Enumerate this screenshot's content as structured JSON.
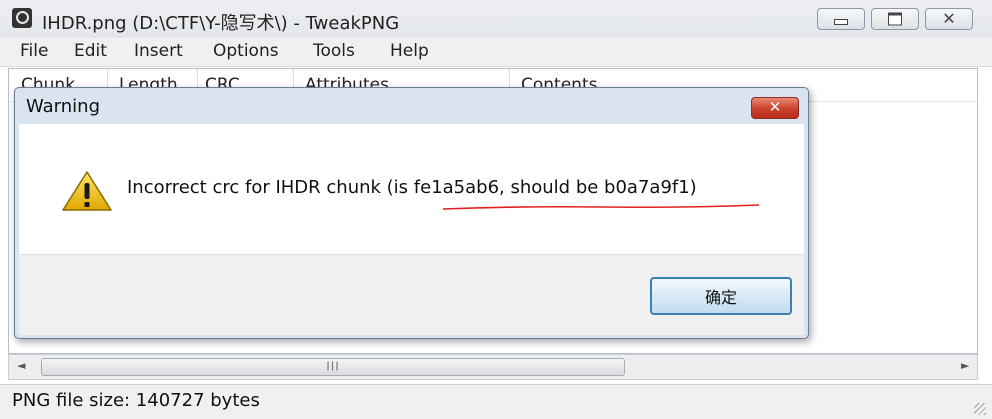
{
  "window": {
    "title": "IHDR.png (D:\\CTF\\Y-隐写术\\) - TweakPNG",
    "icon": "tweakpng-app-icon",
    "controls": {
      "minimize_icon": "minimize-icon",
      "maximize_icon": "maximize-icon",
      "close_glyph": "✕"
    }
  },
  "menu": {
    "items": [
      "File",
      "Edit",
      "Insert",
      "Options",
      "Tools",
      "Help"
    ]
  },
  "list": {
    "columns": [
      "Chunk",
      "Length",
      "CRC",
      "Attributes",
      "Contents"
    ],
    "rows": []
  },
  "scrollbar": {
    "left_arrow": "◄",
    "right_arrow": "►",
    "grip": "III"
  },
  "status": {
    "text": "PNG file size: 140727 bytes"
  },
  "dialog": {
    "title": "Warning",
    "close_glyph": "✕",
    "icon": "warning-icon",
    "message": "Incorrect crc for IHDR chunk (is fe1a5ab6, should be b0a7a9f1)",
    "ok_label": "确定",
    "annotation_color": "#e02020"
  },
  "colors": {
    "dialog_frame": "#dae4f0",
    "ok_border": "#3c7fb1",
    "close_button": "#c9402a",
    "warning_yellow": "#f5c400"
  }
}
